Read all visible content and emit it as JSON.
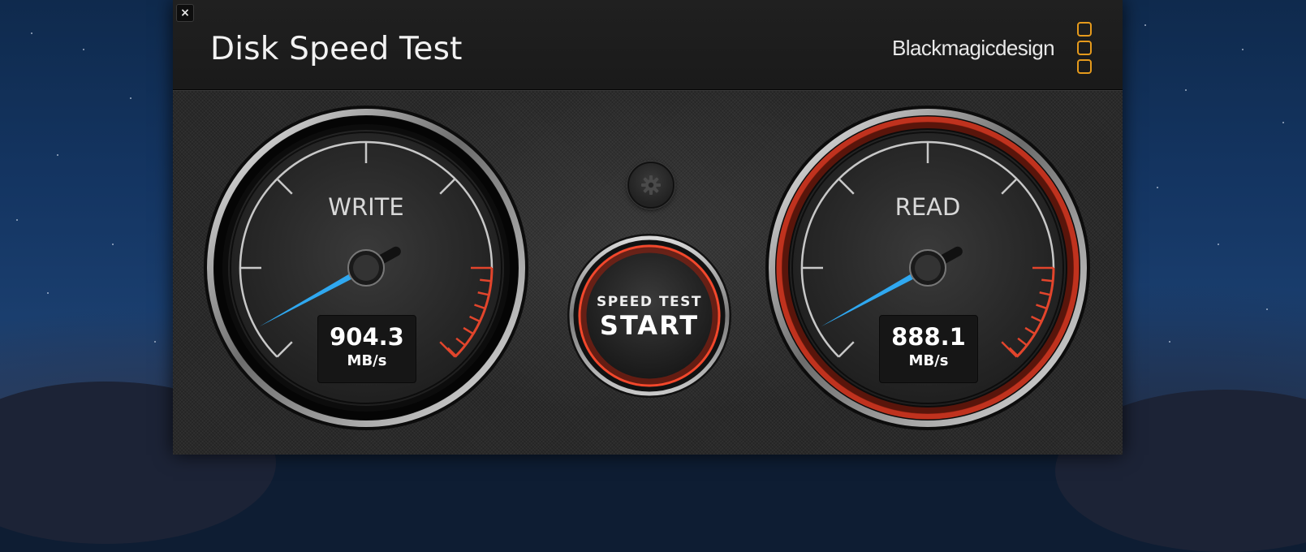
{
  "window": {
    "close_glyph": "×",
    "app_title": "Disk Speed Test",
    "brand_name": "Blackmagicdesign"
  },
  "write_gauge": {
    "label": "WRITE",
    "value": "904.3",
    "unit": "MB/s",
    "needle_level": 0.06
  },
  "read_gauge": {
    "label": "READ",
    "value": "888.1",
    "unit": "MB/s",
    "needle_level": 0.06
  },
  "start_button": {
    "top_label": "SPEED TEST",
    "main_label": "START"
  },
  "colors": {
    "needle": "#2fa8f0",
    "redline": "#e2452c",
    "brand_accent": "#e59a1c",
    "read_ring_glow": "#e03a22"
  },
  "icons": {
    "settings": "gear-icon",
    "close": "close-icon",
    "brand": "blackmagic-logo-icon"
  }
}
